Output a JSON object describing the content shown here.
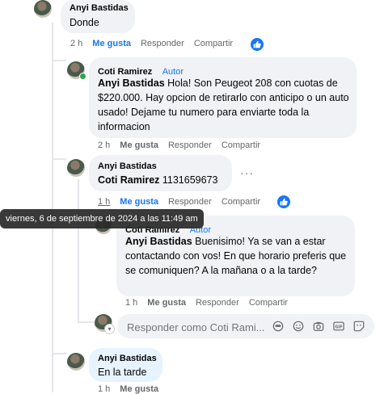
{
  "comments": [
    {
      "name": "Anyi Bastidas",
      "text": "Donde",
      "time": "2 h",
      "like": "Me gusta",
      "reply": "Responder",
      "share": "Compartir"
    },
    {
      "name": "Coti Ramirez",
      "badge": "Autor",
      "mention": "Anyi Bastidas",
      "text": " Hola! Son Peugeot 208 con cuotas de $220.000. Hay opcion de retirarlo con anticipo o un auto usado! Dejame tu numero para enviarte toda la informacion",
      "time": "2 h",
      "like": "Me gusta",
      "reply": "Responder",
      "share": "Compartir"
    },
    {
      "name": "Anyi Bastidas",
      "mention": "Coti Ramirez",
      "text": " 1131659673",
      "time": "1 h",
      "like": "Me gusta",
      "reply": "Responder",
      "share": "Compartir",
      "more": "···"
    },
    {
      "name": "Coti Ramirez",
      "badge": "Autor",
      "mention": "Anyi Bastidas",
      "text": " Buenisimo! Ya se van a estar contactando con vos! En que horario preferis que se comuniquen? A la mañana o a la tarde?",
      "time": "1 h",
      "like": "Me gusta",
      "reply": "Responder",
      "share": "Compartir"
    },
    {
      "name": "Anyi Bastidas",
      "text": "En la tarde",
      "time": "1 h",
      "like": "Me gusta"
    }
  ],
  "tooltip": "viernes, 6 de septiembre de 2024 a las 11:49 am",
  "reply_box": {
    "placeholder": "Responder como Coti Rami..."
  },
  "colors": {
    "accent": "#1877f2",
    "bubble": "#f0f2f5",
    "highlight": "#e7f3ff"
  }
}
